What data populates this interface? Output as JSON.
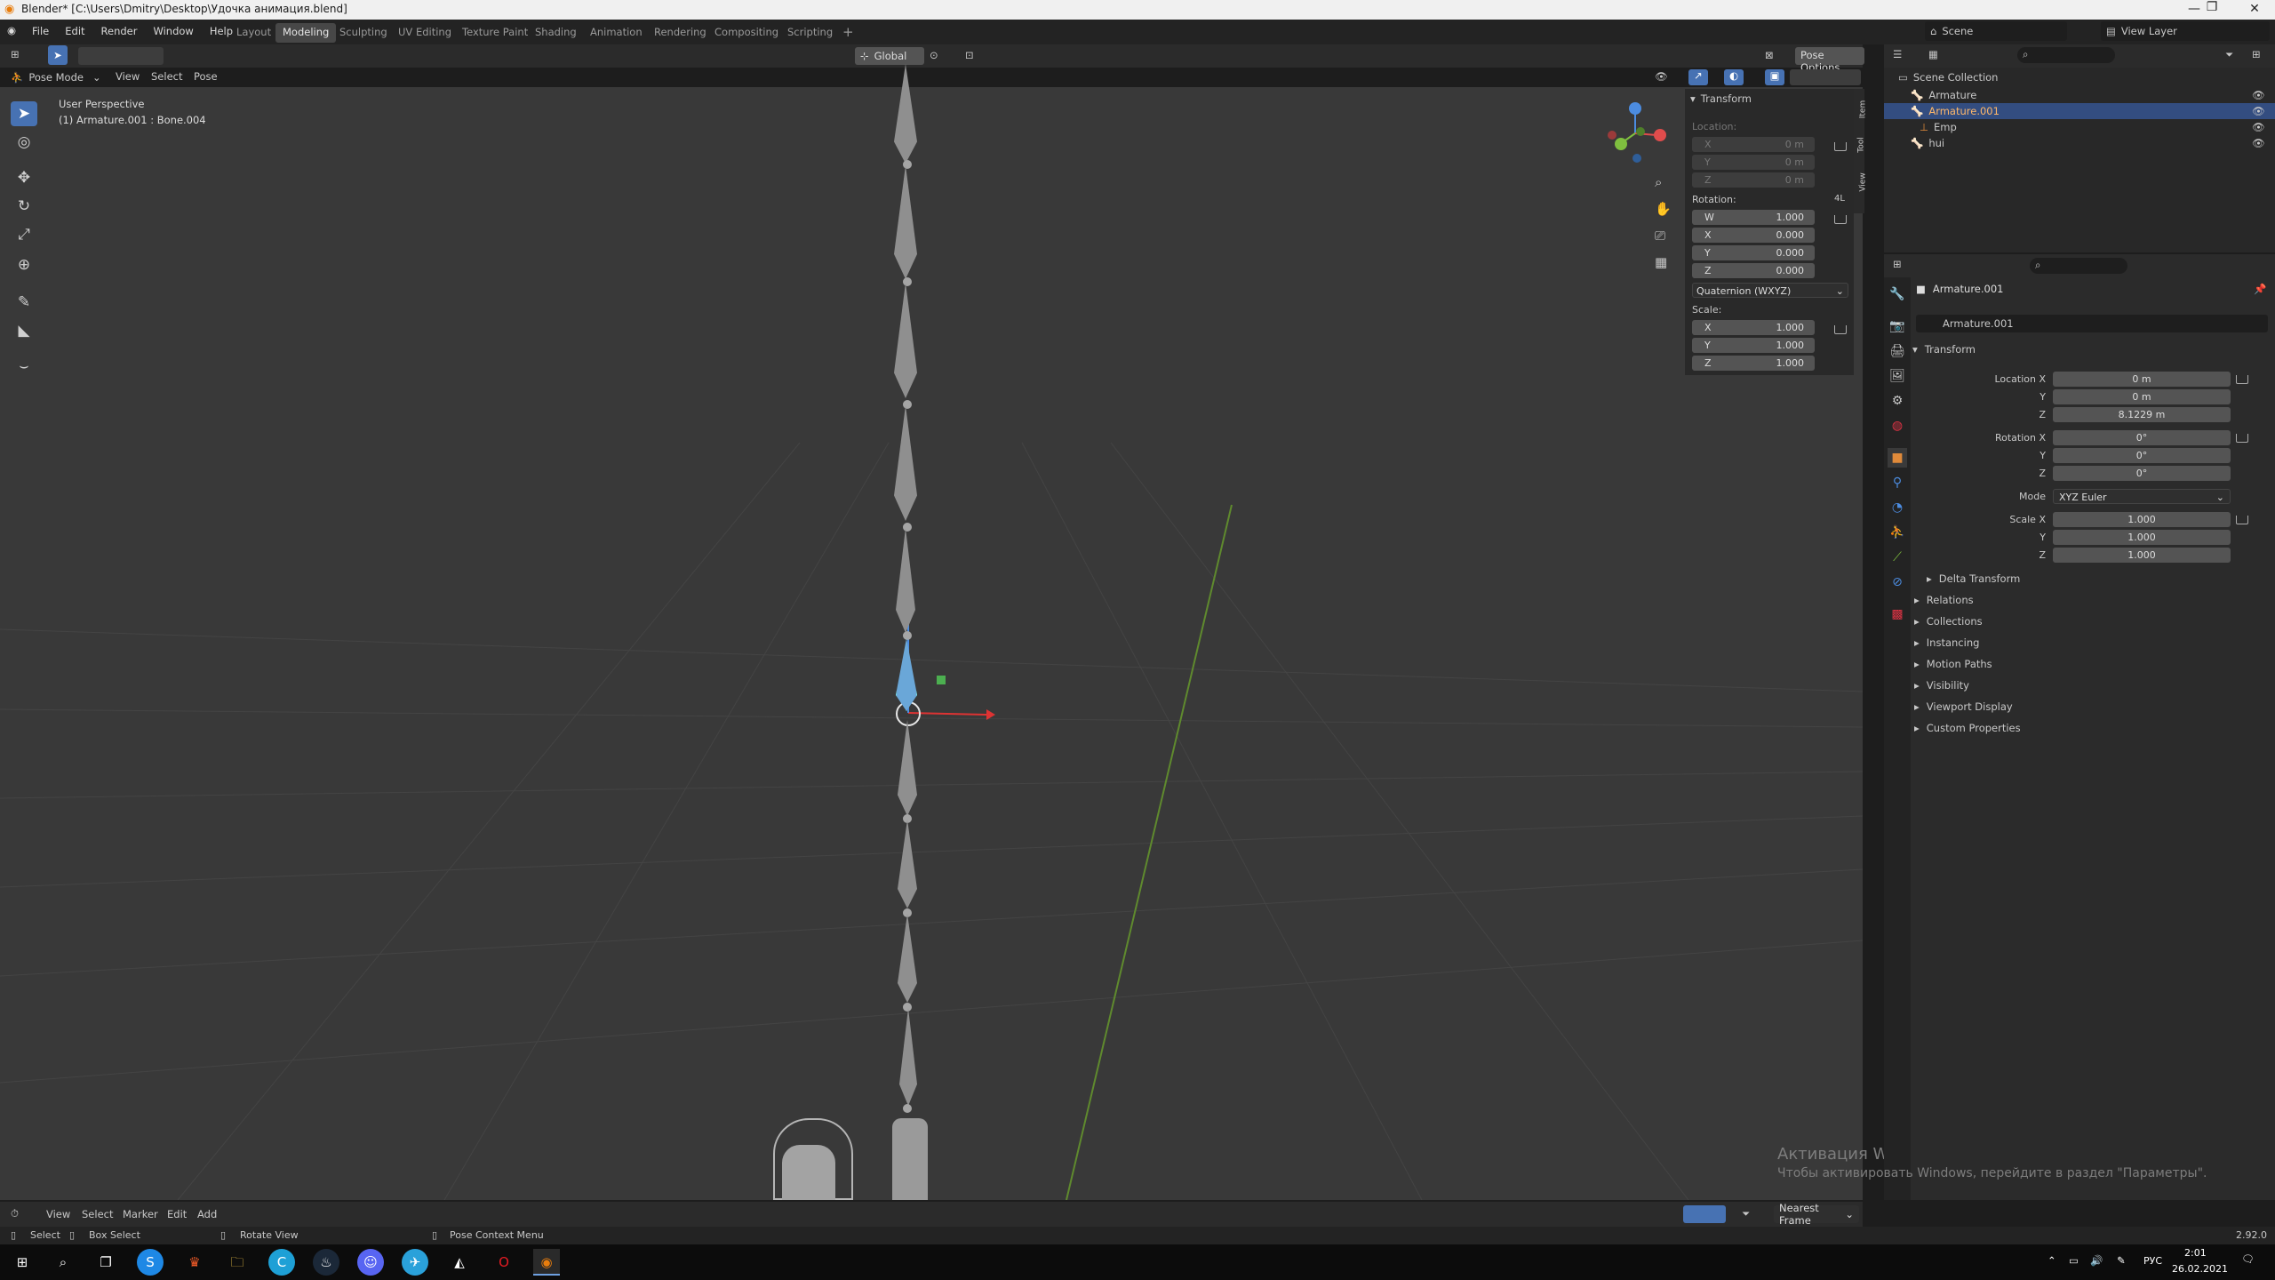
{
  "window": {
    "title": "Blender* [C:\\Users\\Dmitry\\Desktop\\Удочка анимация.blend]"
  },
  "menu": [
    "File",
    "Edit",
    "Render",
    "Window",
    "Help"
  ],
  "workspaces": [
    "Layout",
    "Modeling",
    "Sculpting",
    "UV Editing",
    "Texture Paint",
    "Shading",
    "Animation",
    "Rendering",
    "Compositing",
    "Scripting"
  ],
  "scene": {
    "name": "Scene",
    "view_layer": "View Layer"
  },
  "viewport": {
    "mode": "Pose Mode",
    "menus": [
      "View",
      "Select",
      "Pose"
    ],
    "orientation": "Global",
    "pose_options": "Pose Options",
    "info_line1": "User Perspective",
    "info_line2": "(1) Armature.001 : Bone.004",
    "tabs": [
      "Item",
      "Tool",
      "View"
    ]
  },
  "npanel": {
    "title": "Transform",
    "location_label": "Location:",
    "loc": [
      {
        "k": "X",
        "v": "0 m"
      },
      {
        "k": "Y",
        "v": "0 m"
      },
      {
        "k": "Z",
        "v": "0 m"
      }
    ],
    "rotation_label": "Rotation:",
    "rotation_mode_short": "4L",
    "rot": [
      {
        "k": "W",
        "v": "1.000"
      },
      {
        "k": "X",
        "v": "0.000"
      },
      {
        "k": "Y",
        "v": "0.000"
      },
      {
        "k": "Z",
        "v": "0.000"
      }
    ],
    "rotation_mode": "Quaternion (WXYZ)",
    "scale_label": "Scale:",
    "scale": [
      {
        "k": "X",
        "v": "1.000"
      },
      {
        "k": "Y",
        "v": "1.000"
      },
      {
        "k": "Z",
        "v": "1.000"
      }
    ]
  },
  "outliner": {
    "root": "Scene Collection",
    "items": [
      {
        "label": "Armature"
      },
      {
        "label": "Armature.001"
      },
      {
        "label": "Emp"
      },
      {
        "label": "hui"
      }
    ]
  },
  "properties": {
    "object_name": "Armature.001",
    "data_name": "Armature.001",
    "transform_title": "Transform",
    "location": [
      {
        "label": "Location X",
        "value": "0 m"
      },
      {
        "label": "Y",
        "value": "0 m"
      },
      {
        "label": "Z",
        "value": "8.1229 m"
      }
    ],
    "rotation": [
      {
        "label": "Rotation X",
        "value": "0°"
      },
      {
        "label": "Y",
        "value": "0°"
      },
      {
        "label": "Z",
        "value": "0°"
      }
    ],
    "mode_label": "Mode",
    "mode_value": "XYZ Euler",
    "scale": [
      {
        "label": "Scale X",
        "value": "1.000"
      },
      {
        "label": "Y",
        "value": "1.000"
      },
      {
        "label": "Z",
        "value": "1.000"
      }
    ],
    "sections": [
      "Delta Transform",
      "Relations",
      "Collections",
      "Instancing",
      "Motion Paths",
      "Visibility",
      "Viewport Display",
      "Custom Properties"
    ]
  },
  "timeline": {
    "menus": [
      "View",
      "Select",
      "Marker",
      "Edit",
      "Add"
    ],
    "keying": "Nearest Frame"
  },
  "status": {
    "select": "Select",
    "box_select": "Box Select",
    "rotate_view": "Rotate View",
    "context_menu": "Pose Context Menu",
    "version": "2.92.0"
  },
  "watermark": {
    "line1": "Активация Windows",
    "line2": "Чтобы активировать Windows, перейдите в раздел \"Параметры\"."
  },
  "taskbar": {
    "lang": "РУС",
    "time": "2:01",
    "date": "26.02.2021"
  },
  "colors": {
    "accent": "#4772b3",
    "selected_row": "#334d80",
    "axis_x": "#e04c4c",
    "axis_y": "#7fbf3f",
    "axis_z": "#4c8ce0"
  }
}
